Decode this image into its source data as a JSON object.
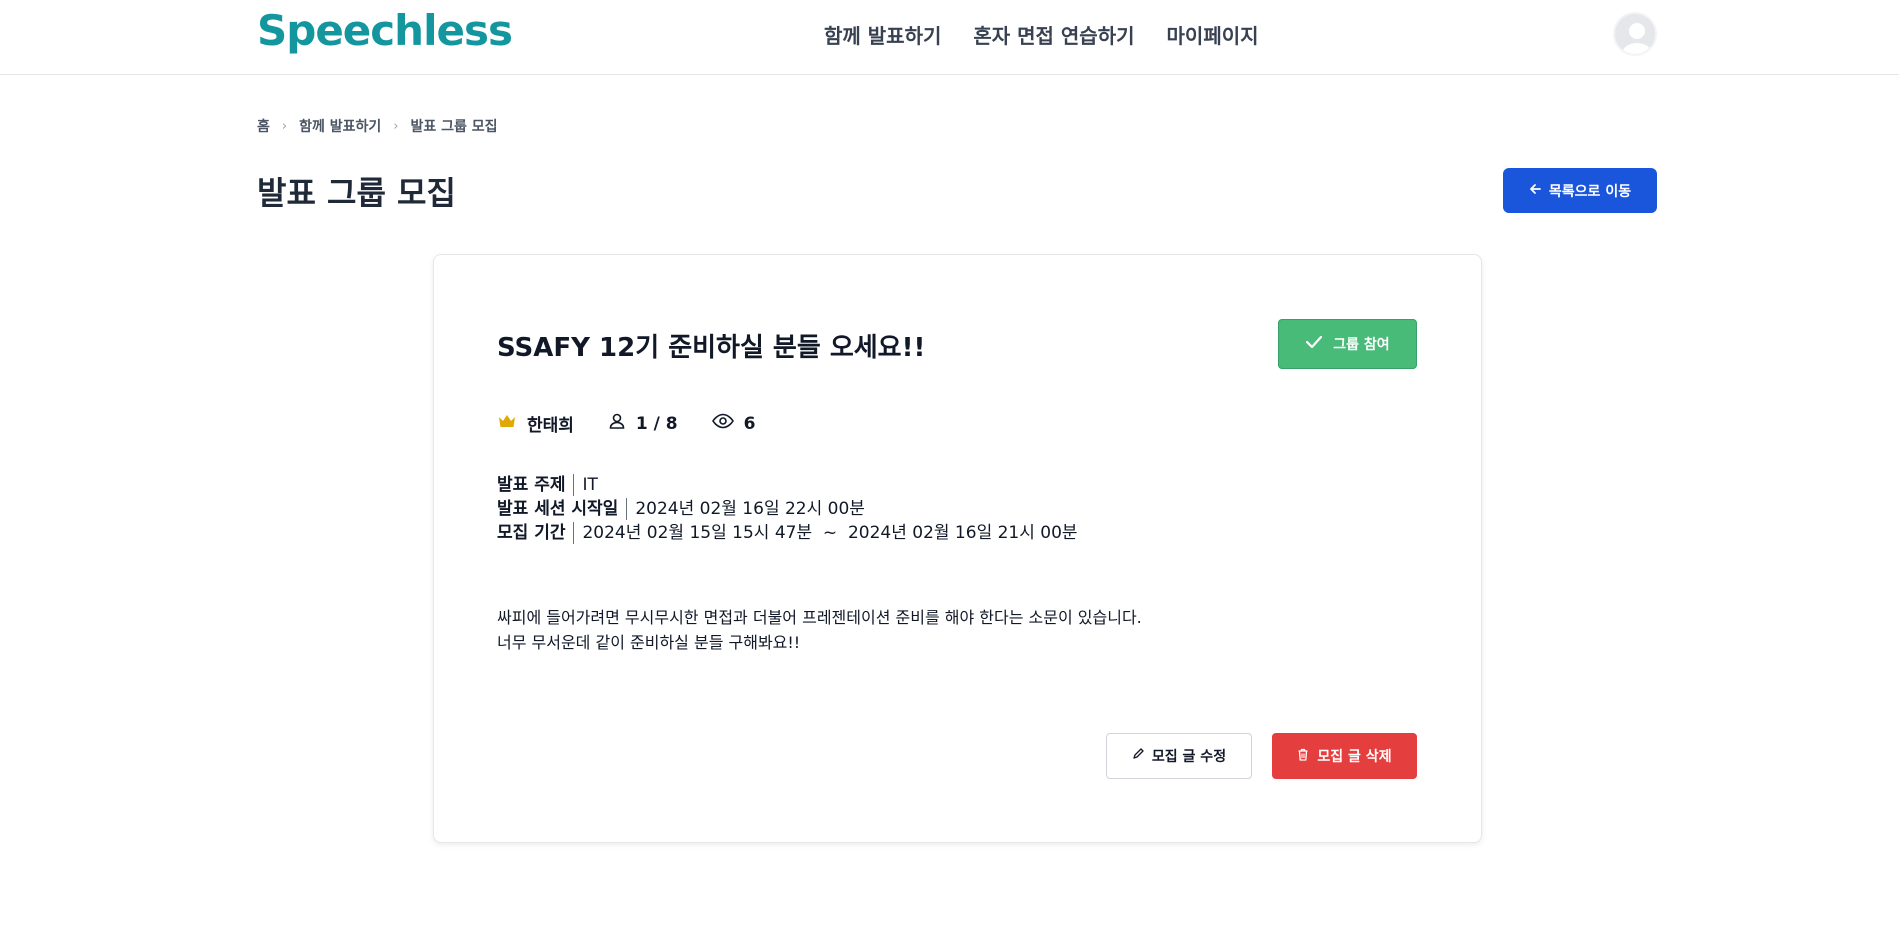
{
  "header": {
    "logo": "Speechless",
    "nav": [
      {
        "label": "함께 발표하기"
      },
      {
        "label": "혼자 면접 연습하기"
      },
      {
        "label": "마이페이지"
      }
    ]
  },
  "breadcrumb": [
    "홈",
    "함께 발표하기",
    "발표 그룹 모집"
  ],
  "page": {
    "title": "발표 그룹 모집",
    "back_label": "목록으로 이동"
  },
  "post": {
    "title": "SSAFY 12기 준비하실 분들 오세요!!",
    "join_label": "그룹 참여",
    "author": "한태희",
    "participants": "1 / 8",
    "views": "6",
    "topic_label": "발표 주제",
    "topic_value": "IT",
    "session_label": "발표 세션 시작일",
    "session_value": "2024년 02월 16일 22시 00분",
    "period_label": "모집 기간",
    "period_value": "2024년 02월 15일 15시 47분  ~  2024년 02월 16일 21시 00분",
    "description": [
      "싸피에 들어가려면 무시무시한 면접과 더불어 프레젠테이션 준비를 해야 한다는 소문이 있습니다.",
      "너무 무서운데 같이 준비하실 분들 구해봐요!!"
    ],
    "edit_label": "모집 글 수정",
    "delete_label": "모집 글 삭제"
  },
  "colors": {
    "brand": "#14969e",
    "primary": "#1a56db",
    "success": "#48bb78",
    "danger": "#e53e3e",
    "crown": "#e0a800"
  }
}
